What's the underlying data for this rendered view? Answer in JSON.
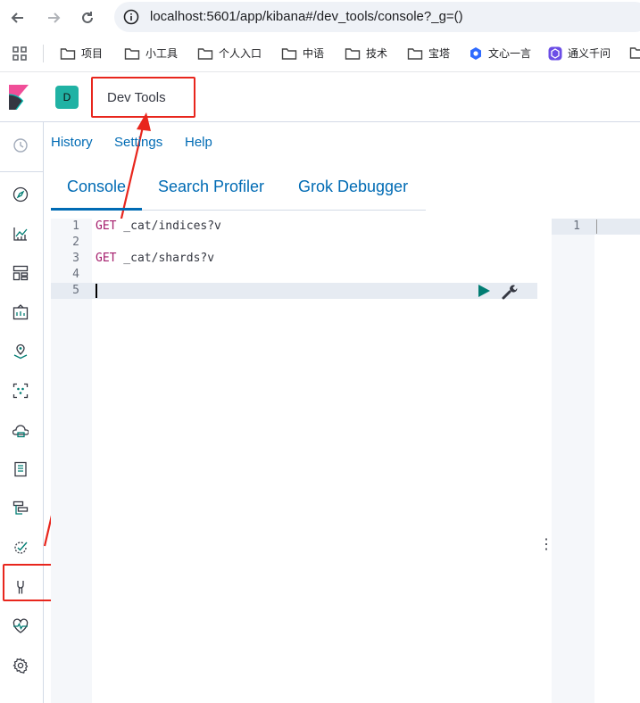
{
  "browser": {
    "url": "localhost:5601/app/kibana#/dev_tools/console?_g=()",
    "bookmarks": [
      {
        "label": "项目",
        "icon": "folder-icon"
      },
      {
        "label": "小工具",
        "icon": "folder-icon"
      },
      {
        "label": "个人入口",
        "icon": "folder-icon"
      },
      {
        "label": "中语",
        "icon": "folder-icon"
      },
      {
        "label": "技术",
        "icon": "folder-icon"
      },
      {
        "label": "宝塔",
        "icon": "folder-icon"
      },
      {
        "label": "文心一言",
        "icon": "wenxin-icon"
      },
      {
        "label": "通义千问",
        "icon": "tongyi-icon"
      }
    ]
  },
  "header": {
    "space_initial": "D",
    "breadcrumb": "Dev Tools"
  },
  "top_links": {
    "history": "History",
    "settings": "Settings",
    "help": "Help"
  },
  "tabs": [
    {
      "label": "Console",
      "active": true
    },
    {
      "label": "Search Profiler",
      "active": false
    },
    {
      "label": "Grok Debugger",
      "active": false
    }
  ],
  "editor": {
    "lines": [
      {
        "number": "1",
        "method": "GET",
        "path": " _cat/indices?v"
      },
      {
        "number": "2",
        "method": "",
        "path": ""
      },
      {
        "number": "3",
        "method": "GET",
        "path": " _cat/shards?v"
      },
      {
        "number": "4",
        "method": "",
        "path": ""
      },
      {
        "number": "5",
        "method": "",
        "path": ""
      }
    ],
    "resizer": "⋮"
  },
  "output": {
    "line_number": "1"
  },
  "colors": {
    "kibana_blue": "#006bb4",
    "highlight_red": "#e8261d",
    "method_color": "#a41d6c",
    "run_green": "#017d73"
  }
}
